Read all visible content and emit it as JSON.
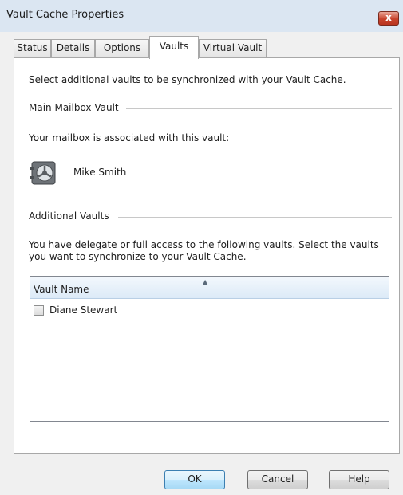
{
  "window": {
    "title": "Vault Cache Properties",
    "close_label": "x"
  },
  "tabs": [
    {
      "label": "Status",
      "active": false
    },
    {
      "label": "Details",
      "active": false
    },
    {
      "label": "Options",
      "active": false
    },
    {
      "label": "Vaults",
      "active": true
    },
    {
      "label": "Virtual Vault",
      "active": false
    }
  ],
  "vaults_tab": {
    "intro": "Select additional vaults to be synchronized with your Vault Cache.",
    "main_section": {
      "title": "Main Mailbox Vault",
      "associated_text": "Your mailbox is associated with this vault:",
      "vault_owner": "Mike Smith",
      "icon": "vault-safe-icon"
    },
    "additional_section": {
      "title": "Additional Vaults",
      "description_line1": "You have delegate or full access to the following vaults. Select the vaults",
      "description_line2": "you want to synchronize to your Vault Cache.",
      "list": {
        "column_header": "Vault Name",
        "sort": "ascending",
        "rows": [
          {
            "name": "Diane Stewart",
            "checked": false
          }
        ]
      }
    }
  },
  "buttons": {
    "ok": "OK",
    "cancel": "Cancel",
    "help": "Help"
  },
  "colors": {
    "titlebar": "#dbe6f2",
    "close_button": "#c8432c",
    "default_button": "#bee6fd",
    "list_header": "#dceaf7"
  }
}
